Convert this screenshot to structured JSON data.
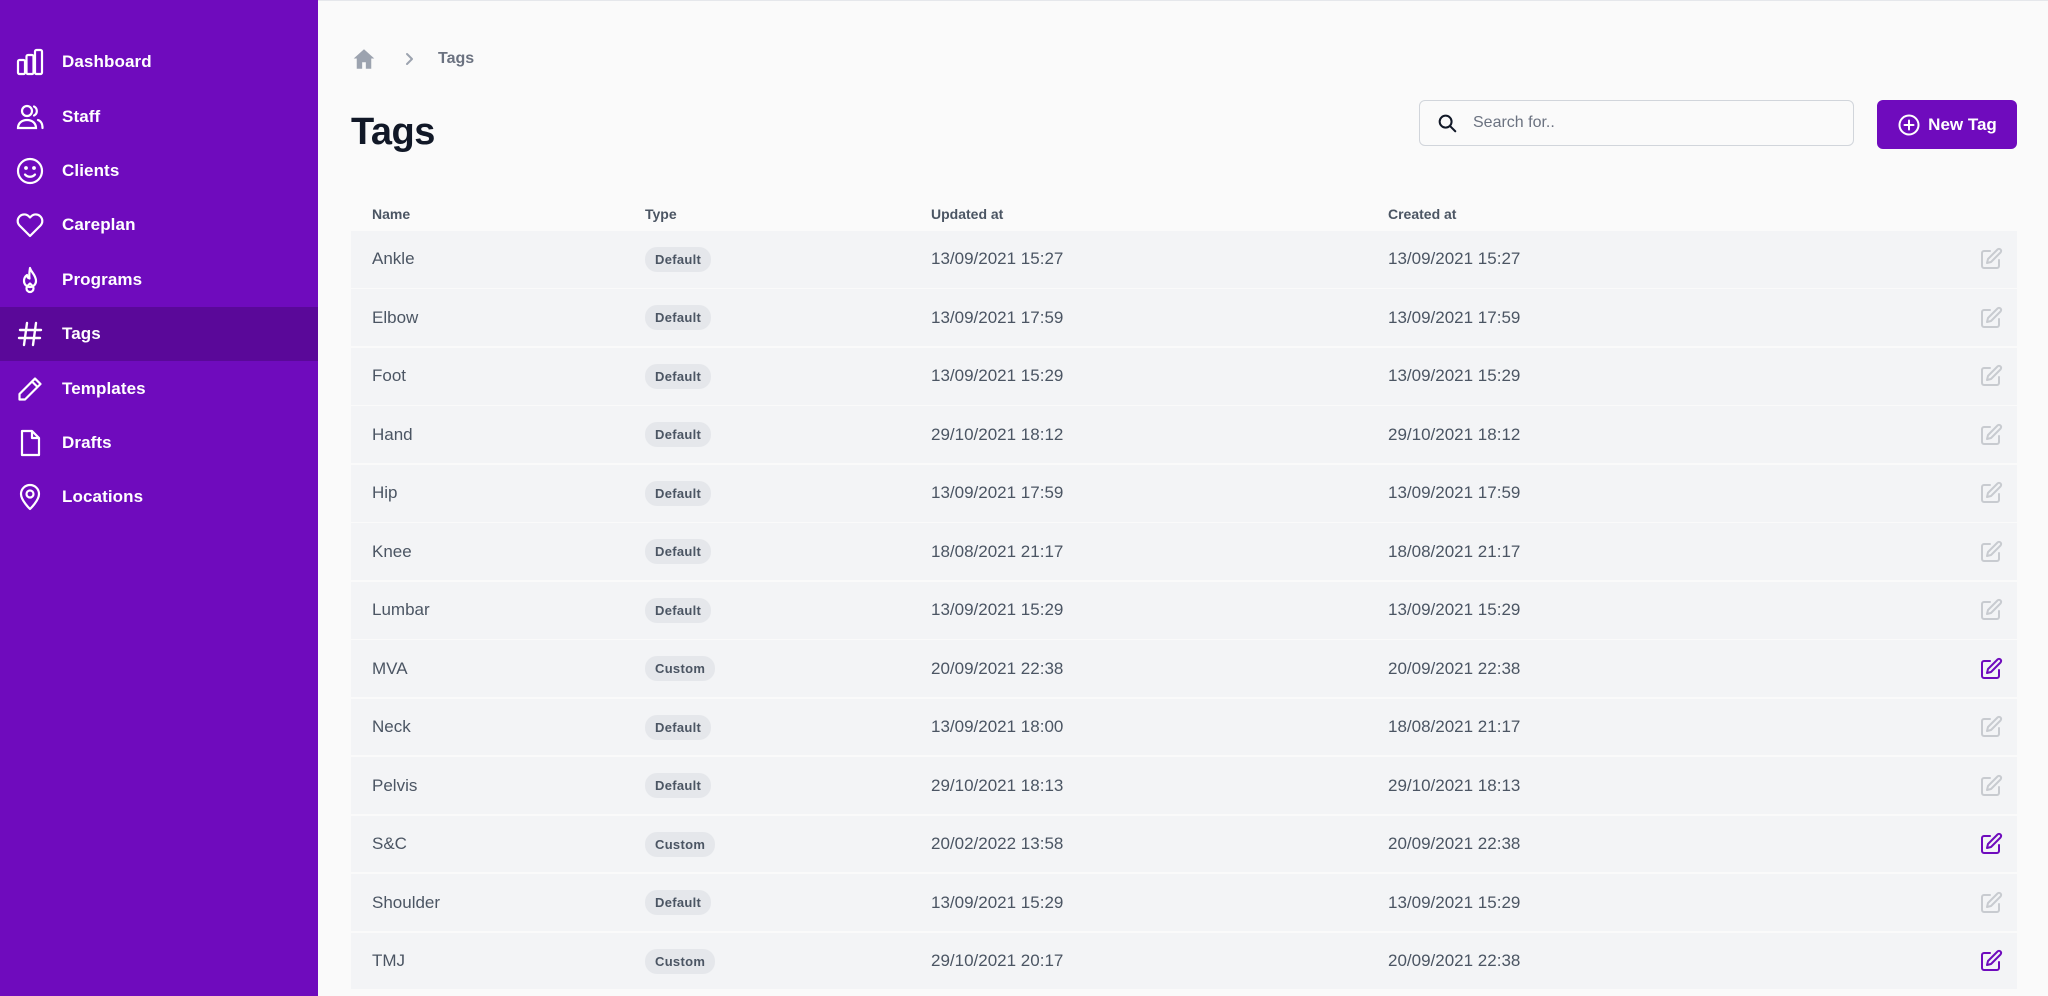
{
  "sidebar": {
    "items": [
      {
        "label": "Dashboard",
        "icon": "chart-bar-icon",
        "active": false
      },
      {
        "label": "Staff",
        "icon": "users-icon",
        "active": false
      },
      {
        "label": "Clients",
        "icon": "smile-icon",
        "active": false
      },
      {
        "label": "Careplan",
        "icon": "heart-icon",
        "active": false
      },
      {
        "label": "Programs",
        "icon": "fire-icon",
        "active": false
      },
      {
        "label": "Tags",
        "icon": "hashtag-icon",
        "active": true
      },
      {
        "label": "Templates",
        "icon": "pencil-icon",
        "active": false
      },
      {
        "label": "Drafts",
        "icon": "document-icon",
        "active": false
      },
      {
        "label": "Locations",
        "icon": "location-pin-icon",
        "active": false
      }
    ]
  },
  "breadcrumb": {
    "home_icon": "home-icon",
    "separator_icon": "chevron-right-icon",
    "current": "Tags"
  },
  "header": {
    "title": "Tags"
  },
  "search": {
    "placeholder": "Search for..",
    "value": "",
    "icon": "search-icon"
  },
  "new_button": {
    "label": "New Tag",
    "icon": "plus-circle-icon"
  },
  "table": {
    "columns": [
      "Name",
      "Type",
      "Updated at",
      "Created at"
    ],
    "rows": [
      {
        "name": "Ankle",
        "type": "Default",
        "updated": "13/09/2021 15:27",
        "created": "13/09/2021 15:27",
        "editable": false
      },
      {
        "name": "Elbow",
        "type": "Default",
        "updated": "13/09/2021 17:59",
        "created": "13/09/2021 17:59",
        "editable": false
      },
      {
        "name": "Foot",
        "type": "Default",
        "updated": "13/09/2021 15:29",
        "created": "13/09/2021 15:29",
        "editable": false
      },
      {
        "name": "Hand",
        "type": "Default",
        "updated": "29/10/2021 18:12",
        "created": "29/10/2021 18:12",
        "editable": false
      },
      {
        "name": "Hip",
        "type": "Default",
        "updated": "13/09/2021 17:59",
        "created": "13/09/2021 17:59",
        "editable": false
      },
      {
        "name": "Knee",
        "type": "Default",
        "updated": "18/08/2021 21:17",
        "created": "18/08/2021 21:17",
        "editable": false
      },
      {
        "name": "Lumbar",
        "type": "Default",
        "updated": "13/09/2021 15:29",
        "created": "13/09/2021 15:29",
        "editable": false
      },
      {
        "name": "MVA",
        "type": "Custom",
        "updated": "20/09/2021 22:38",
        "created": "20/09/2021 22:38",
        "editable": true
      },
      {
        "name": "Neck",
        "type": "Default",
        "updated": "13/09/2021 18:00",
        "created": "18/08/2021 21:17",
        "editable": false
      },
      {
        "name": "Pelvis",
        "type": "Default",
        "updated": "29/10/2021 18:13",
        "created": "29/10/2021 18:13",
        "editable": false
      },
      {
        "name": "S&C",
        "type": "Custom",
        "updated": "20/02/2022 13:58",
        "created": "20/09/2021 22:38",
        "editable": true
      },
      {
        "name": "Shoulder",
        "type": "Default",
        "updated": "13/09/2021 15:29",
        "created": "13/09/2021 15:29",
        "editable": false
      },
      {
        "name": "TMJ",
        "type": "Custom",
        "updated": "29/10/2021 20:17",
        "created": "20/09/2021 22:38",
        "editable": true
      }
    ]
  },
  "colors": {
    "brand": "#6f0bbd",
    "brand_active": "#5a0899",
    "edit_enabled": "#6f0bbd",
    "edit_disabled": "#c8cbd0"
  }
}
